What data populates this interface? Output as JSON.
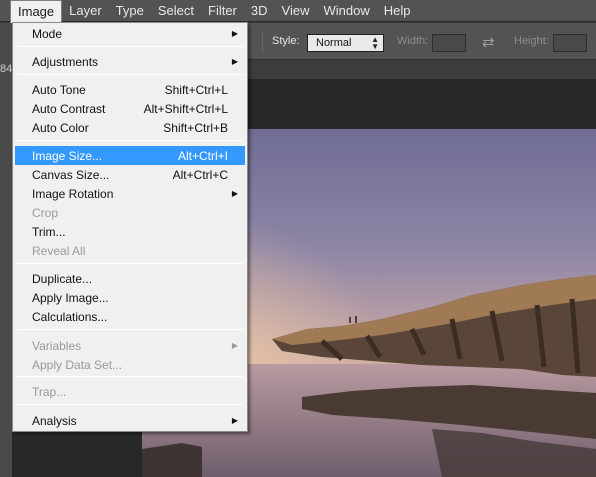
{
  "menubar": {
    "items": [
      "Image",
      "Layer",
      "Type",
      "Select",
      "Filter",
      "3D",
      "View",
      "Window",
      "Help"
    ],
    "active": "Image"
  },
  "options": {
    "style_label": "Style:",
    "style_value": "Normal",
    "width_label": "Width:",
    "height_label": "Height:",
    "swap_icon": "swap-arrows-icon"
  },
  "doc_tab_fragment": "84",
  "image_menu": {
    "mode": "Mode",
    "adjustments": "Adjustments",
    "auto_tone": "Auto Tone",
    "auto_tone_sc": "Shift+Ctrl+L",
    "auto_contrast": "Auto Contrast",
    "auto_contrast_sc": "Alt+Shift+Ctrl+L",
    "auto_color": "Auto Color",
    "auto_color_sc": "Shift+Ctrl+B",
    "image_size": "Image Size...",
    "image_size_sc": "Alt+Ctrl+I",
    "canvas_size": "Canvas Size...",
    "canvas_size_sc": "Alt+Ctrl+C",
    "image_rotation": "Image Rotation",
    "crop": "Crop",
    "trim": "Trim...",
    "reveal_all": "Reveal All",
    "duplicate": "Duplicate...",
    "apply_image": "Apply Image...",
    "calculations": "Calculations...",
    "variables": "Variables",
    "apply_data_set": "Apply Data Set...",
    "trap": "Trap...",
    "analysis": "Analysis",
    "highlighted": "Image Size..."
  },
  "colors": {
    "highlight": "#3399ff",
    "menu_bg": "#f0f0f0",
    "chrome": "#535353"
  }
}
